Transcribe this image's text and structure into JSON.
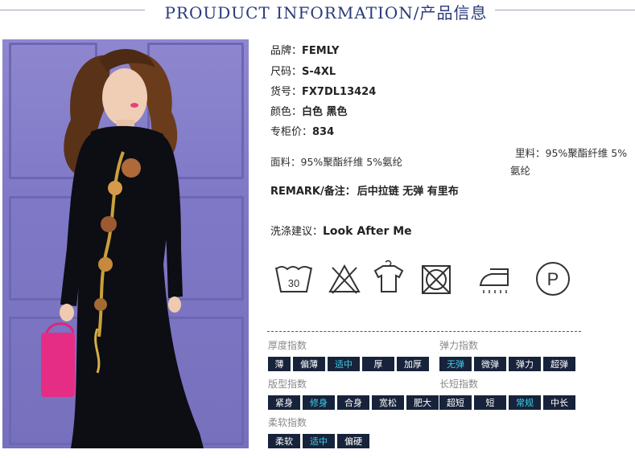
{
  "header": {
    "title": "PROUDUCT INFORMATION/产品信息"
  },
  "specs": [
    {
      "label": "品牌：",
      "value": "FEMLY"
    },
    {
      "label": "尺码：",
      "value": "S-4XL"
    },
    {
      "label": "货号：",
      "value": "FX7DL13424"
    },
    {
      "label": "颜色：",
      "value": "白色 黑色"
    },
    {
      "label": "专柜价：",
      "value": "834"
    }
  ],
  "fabric": {
    "outer_label": "面料：",
    "outer_value": "95%聚酯纤维 5%氨纶",
    "lining_label": "里料：",
    "lining_value_line1": "95%聚酯纤维 5%",
    "lining_value_line2": "氨纶"
  },
  "remark": {
    "label": "REMARK/备注：",
    "value": "后中拉链 无弹 有里布"
  },
  "wash": {
    "label": "洗涤建议：",
    "value": "Look After Me"
  },
  "care_icons": [
    {
      "name": "wash-30-icon",
      "text": "30"
    },
    {
      "name": "no-bleach-icon"
    },
    {
      "name": "hang-dry-icon"
    },
    {
      "name": "no-tumble-dry-icon"
    },
    {
      "name": "iron-icon"
    },
    {
      "name": "dry-clean-p-icon",
      "text": "P"
    }
  ],
  "indices": {
    "thickness": {
      "title": "厚度指数",
      "options": [
        "薄",
        "偏薄",
        "适中",
        "厚",
        "加厚"
      ],
      "selected": "适中"
    },
    "elasticity": {
      "title": "弹力指数",
      "options": [
        "无弹",
        "微弹",
        "弹力",
        "超弹"
      ],
      "selected": "无弹"
    },
    "fit": {
      "title": "版型指数",
      "options": [
        "紧身",
        "修身",
        "合身",
        "宽松",
        "肥大"
      ],
      "selected": "修身"
    },
    "length": {
      "title": "长短指数",
      "options": [
        "超短",
        "短",
        "常规",
        "中长"
      ],
      "selected": "常规"
    },
    "softness": {
      "title": "柔软指数",
      "options": [
        "柔软",
        "适中",
        "偏硬"
      ],
      "selected": "适中"
    }
  },
  "colors": {
    "title": "#2a3a7a",
    "chip_bg": "#17233b",
    "chip_selected_text": "#3fd0e8"
  }
}
